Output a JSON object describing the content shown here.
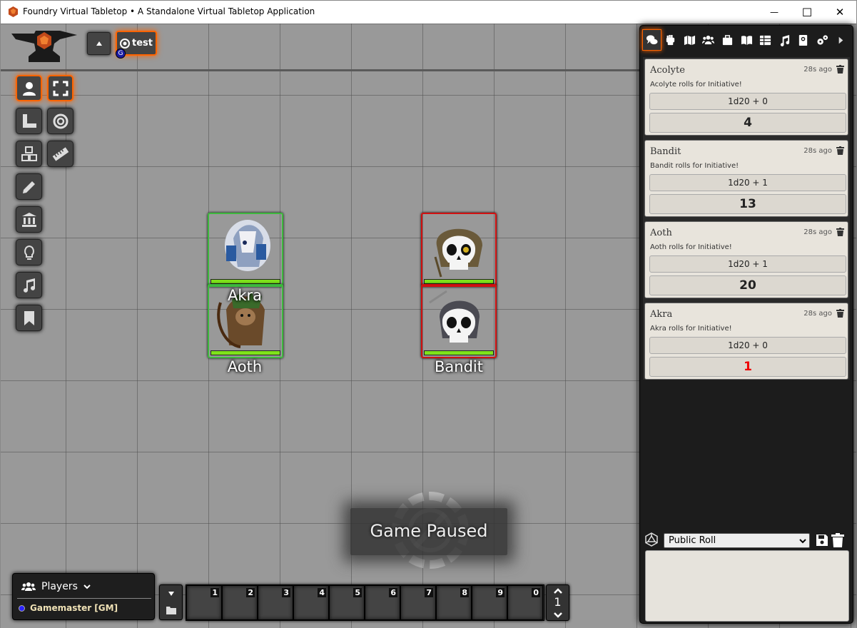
{
  "window": {
    "title": "Foundry Virtual Tabletop • A Standalone Virtual Tabletop Application",
    "minimize": "—",
    "maximize": "☐",
    "close": "✕"
  },
  "scene_nav": {
    "scene_name": "test",
    "badge": "G"
  },
  "controls": [
    {
      "icon": "user-icon",
      "active": true
    },
    {
      "icon": "expand-icon",
      "active": true
    },
    {
      "icon": "ruler-square-icon",
      "active": false
    },
    {
      "icon": "target-icon",
      "active": false
    },
    {
      "icon": "cubes-icon",
      "active": false
    },
    {
      "icon": "ruler-icon",
      "active": false
    },
    {
      "icon": "pencil-icon",
      "active": false
    },
    {
      "icon": "landmark-icon",
      "active": false
    },
    {
      "icon": "lightbulb-icon",
      "active": false
    },
    {
      "icon": "music-icon",
      "active": false
    },
    {
      "icon": "bookmark-icon",
      "active": false
    }
  ],
  "tokens": [
    {
      "name": "Akra",
      "disposition": "friendly"
    },
    {
      "name": "Aoth",
      "disposition": "friendly"
    },
    {
      "name": "Acolyte",
      "disposition": "hostile"
    },
    {
      "name": "Bandit",
      "disposition": "hostile"
    }
  ],
  "token_labels": {
    "akra": "Akra",
    "aoth": "Aoth",
    "bandit": "Bandit"
  },
  "pause": {
    "text": "Game Paused"
  },
  "players": {
    "header": "Players",
    "gm": "Gamemaster [GM]",
    "gm_color": "#2a22ff"
  },
  "hotbar": {
    "slots": [
      "1",
      "2",
      "3",
      "4",
      "5",
      "6",
      "7",
      "8",
      "9",
      "0"
    ],
    "page": "1"
  },
  "sidebar": {
    "tabs": [
      "chat-icon",
      "combat-fist-icon",
      "map-icon",
      "users-icon",
      "suitcase-icon",
      "book-open-icon",
      "table-icon",
      "music-icon",
      "compendium-icon",
      "cogs-icon",
      "collapse-icon"
    ],
    "messages": [
      {
        "sender": "Acolyte",
        "time": "28s ago",
        "flavor": "Acolyte rolls for Initiative!",
        "formula": "1d20 + 0",
        "total": "4",
        "fumble": false
      },
      {
        "sender": "Bandit",
        "time": "28s ago",
        "flavor": "Bandit rolls for Initiative!",
        "formula": "1d20 + 1",
        "total": "13",
        "fumble": false
      },
      {
        "sender": "Aoth",
        "time": "28s ago",
        "flavor": "Aoth rolls for Initiative!",
        "formula": "1d20 + 1",
        "total": "20",
        "fumble": false
      },
      {
        "sender": "Akra",
        "time": "28s ago",
        "flavor": "Akra rolls for Initiative!",
        "formula": "1d20 + 0",
        "total": "1",
        "fumble": true
      }
    ],
    "roll_mode": "Public Roll"
  },
  "colors": {
    "accent": "#ff6400",
    "friendly": "#3db83d",
    "hostile": "#d01010",
    "hp": "#7ee21a",
    "fumble": "#e00000"
  }
}
